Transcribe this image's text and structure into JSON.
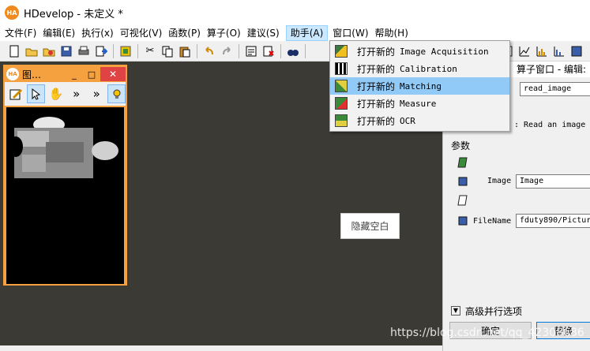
{
  "titlebar": {
    "logo": "HA",
    "title": "HDevelop - 未定义 *"
  },
  "menubar": {
    "items": [
      {
        "label": "文件(F)"
      },
      {
        "label": "编辑(E)"
      },
      {
        "label": "执行(x)"
      },
      {
        "label": "可视化(V)"
      },
      {
        "label": "函数(P)"
      },
      {
        "label": "算子(O)"
      },
      {
        "label": "建议(S)"
      },
      {
        "label": "助手(A)"
      },
      {
        "label": "窗口(W)"
      },
      {
        "label": "帮助(H)"
      }
    ],
    "open_index": 7
  },
  "toolbar": {
    "icons": [
      "new-file-icon",
      "open-folder-icon",
      "open-example-icon",
      "save-icon",
      "print-icon",
      "export-icon",
      "insert-icon",
      "cut-icon",
      "copy-icon",
      "paste-icon",
      "undo-icon",
      "redo-icon",
      "edit-icon",
      "delete-icon",
      "find-icon"
    ]
  },
  "assistant_menu": {
    "items": [
      {
        "prefix": "打开新的",
        "label": "Image Acquisition",
        "icon": "camera-assistant-icon",
        "highlighted": false
      },
      {
        "prefix": "打开新的",
        "label": "Calibration",
        "icon": "calibration-assistant-icon",
        "highlighted": false
      },
      {
        "prefix": "打开新的",
        "label": "Matching",
        "icon": "matching-assistant-icon",
        "highlighted": true
      },
      {
        "prefix": "打开新的",
        "label": "Measure",
        "icon": "measure-assistant-icon",
        "highlighted": false
      },
      {
        "prefix": "打开新的",
        "label": "OCR",
        "icon": "ocr-assistant-icon",
        "highlighted": false
      }
    ]
  },
  "graphics_window": {
    "logo": "HA",
    "title": "图…",
    "minimize": "_",
    "maximize": "□",
    "close": "✕",
    "more": "»"
  },
  "hidden_label": "隐藏空白",
  "operator_panel": {
    "title": "算子窗口 - 编辑:",
    "operator_name": "read_image",
    "description": ": Read an image w",
    "params_heading": "参数",
    "params": [
      {
        "name": "Image",
        "value": "Image"
      },
      {
        "name": "FileName",
        "value": "fduty890/Pictur"
      }
    ],
    "advanced_label": "高级并行选项",
    "ok_label": "确定",
    "replace_label": "替换"
  },
  "watermark": "https://blog.csdn.net/qq_42308686"
}
